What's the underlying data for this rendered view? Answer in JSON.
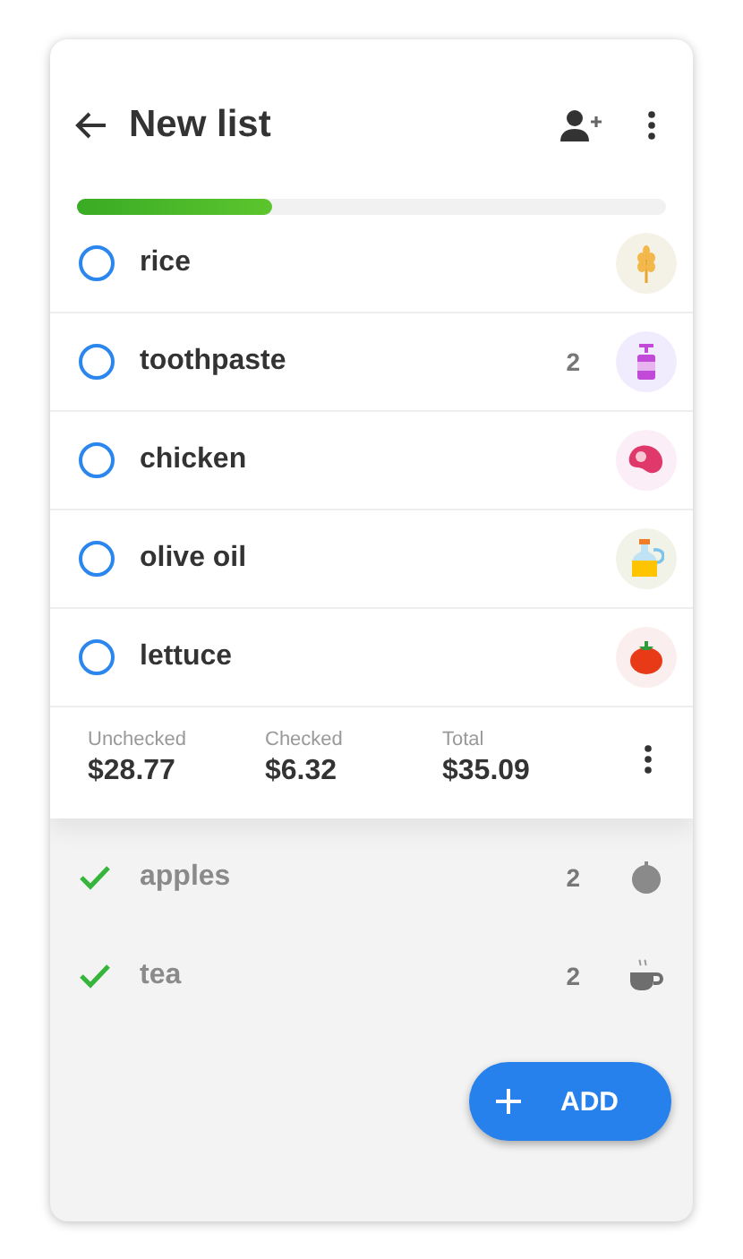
{
  "header": {
    "title": "New list"
  },
  "progress": {
    "level": 0.33
  },
  "items": [
    {
      "name": "rice",
      "checked": false
    },
    {
      "name": "toothpaste",
      "checked": false,
      "quantity": "2"
    },
    {
      "name": "chicken",
      "checked": false
    },
    {
      "name": "olive oil",
      "checked": false
    },
    {
      "name": "lettuce",
      "checked": false
    },
    {
      "name": "apples",
      "checked": true,
      "quantity": "2"
    },
    {
      "name": "tea",
      "checked": true,
      "quantity": "2"
    }
  ],
  "summary": [
    {
      "label": "Unchecked",
      "value": "$28.77"
    },
    {
      "label": "Checked",
      "value": "$6.32"
    },
    {
      "label": "Total",
      "value": "$35.09"
    }
  ],
  "add_button": {
    "label": "ADD"
  }
}
